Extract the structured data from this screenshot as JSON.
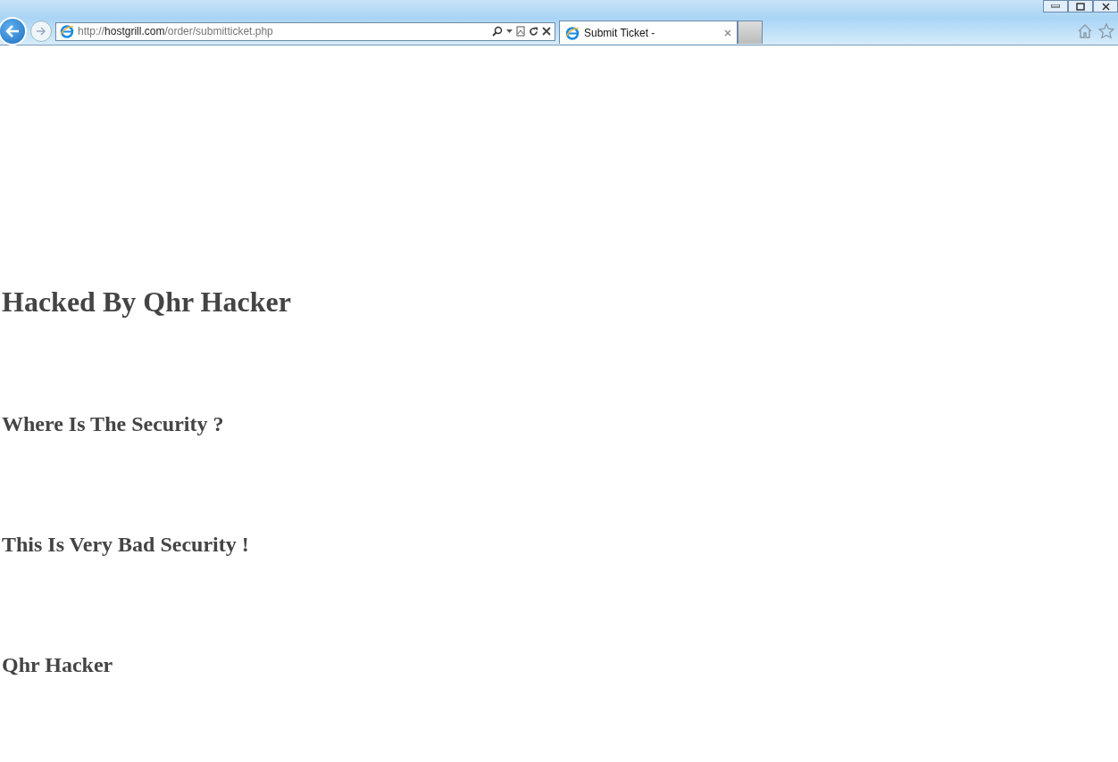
{
  "address_bar": {
    "scheme": "http://",
    "host": "hostgrill.com",
    "path": "/order/submitticket.php"
  },
  "tabs": [
    {
      "label": "Submit Ticket -",
      "selected": true
    }
  ],
  "page": {
    "title": "Hacked By Qhr Hacker",
    "lines": [
      "Where Is The Security ?",
      "This Is Very Bad Security !",
      "Qhr Hacker"
    ]
  }
}
